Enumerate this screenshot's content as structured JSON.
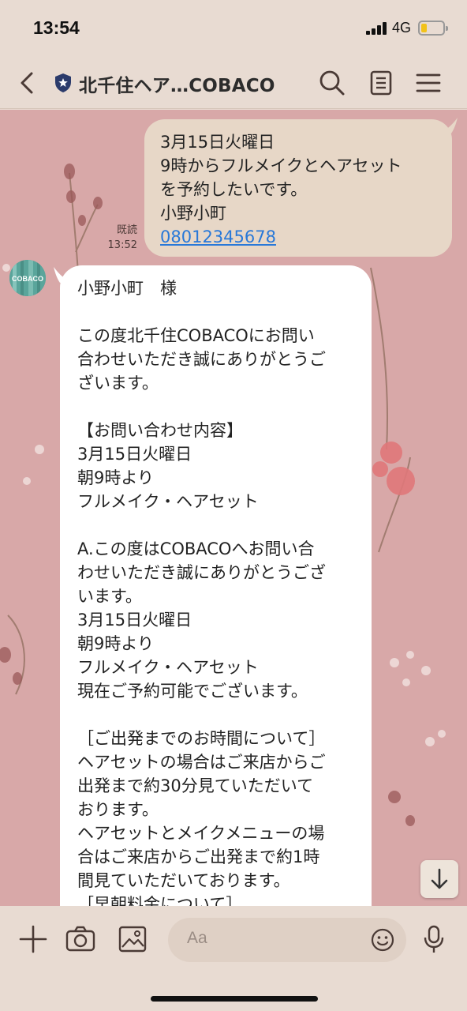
{
  "status_bar": {
    "time": "13:54",
    "network": "4G",
    "battery_level": 0.25
  },
  "header": {
    "title": "北千住ヘア…COBACO"
  },
  "messages": {
    "sent": {
      "lines": [
        "3月15日火曜日",
        "9時からフルメイクとヘアセット",
        "を予約したいです。",
        "小野小町"
      ],
      "phone": "08012345678",
      "read_label": "既読",
      "time": "13:52"
    },
    "received": {
      "avatar_text": "COBACO",
      "lines": [
        "小野小町　様",
        "",
        "この度北千住COBACOにお問い",
        "合わせいただき誠にありがとうご",
        "ざいます。",
        "",
        "【お問い合わせ内容】",
        "3月15日火曜日",
        "朝9時より",
        "フルメイク・ヘアセット",
        "",
        "A.この度はCOBACOへお問い合",
        "わせいただき誠にありがとうござ",
        "います。",
        "3月15日火曜日",
        "朝9時より",
        "フルメイク・ヘアセット",
        "現在ご予約可能でございます。",
        "",
        "［ご出発までのお時間について］",
        "ヘアセットの場合はご来店からご",
        "出発まで約30分見ていただいて",
        "おります。",
        "ヘアセットとメイクメニューの場",
        "合はご来店からご出発まで約1時",
        "間見ていただいております。",
        "［早朝料金について］"
      ]
    }
  },
  "input_bar": {
    "placeholder": "Aa"
  }
}
